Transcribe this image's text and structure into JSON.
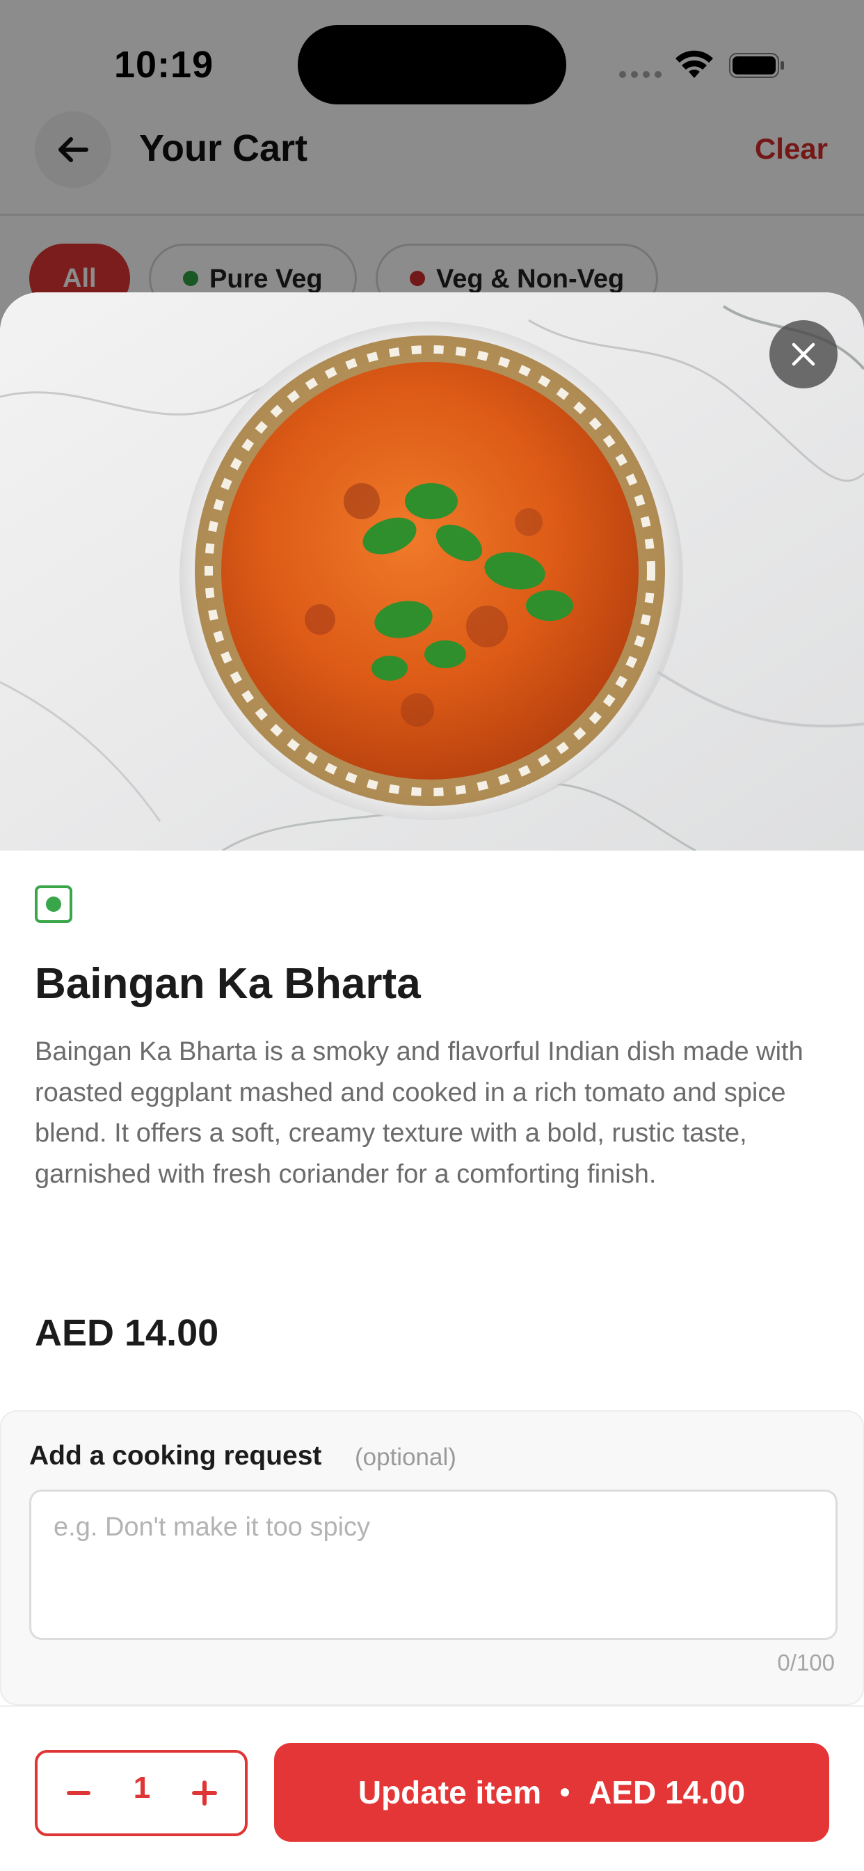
{
  "status_bar": {
    "time": "10:19"
  },
  "header": {
    "title": "Your Cart",
    "clear_label": "Clear"
  },
  "filters": [
    {
      "label": "All",
      "active": true
    },
    {
      "label": "Pure Veg",
      "dot_color": "#2e9e44"
    },
    {
      "label": "Veg & Non-Veg",
      "dot_color": "#d22c2c"
    }
  ],
  "item": {
    "veg_indicator_color": "#3aa64a",
    "name": "Baingan Ka Bharta",
    "description": "Baingan Ka Bharta is a smoky and flavorful Indian dish made with roasted eggplant mashed and cooked in a rich tomato and spice blend. It offers a soft, creamy texture with a bold, rustic taste, garnished with fresh coriander for a comforting finish.",
    "price": "AED 14.00"
  },
  "cooking_request": {
    "title": "Add a cooking request",
    "optional_label": "(optional)",
    "placeholder": "e.g. Don't make it too spicy",
    "value": "",
    "char_count": "0/100"
  },
  "cart_action": {
    "quantity": "1",
    "update_label": "Update item",
    "update_price": "AED 14.00"
  },
  "colors": {
    "accent": "#e43636",
    "veg": "#3aa64a"
  }
}
